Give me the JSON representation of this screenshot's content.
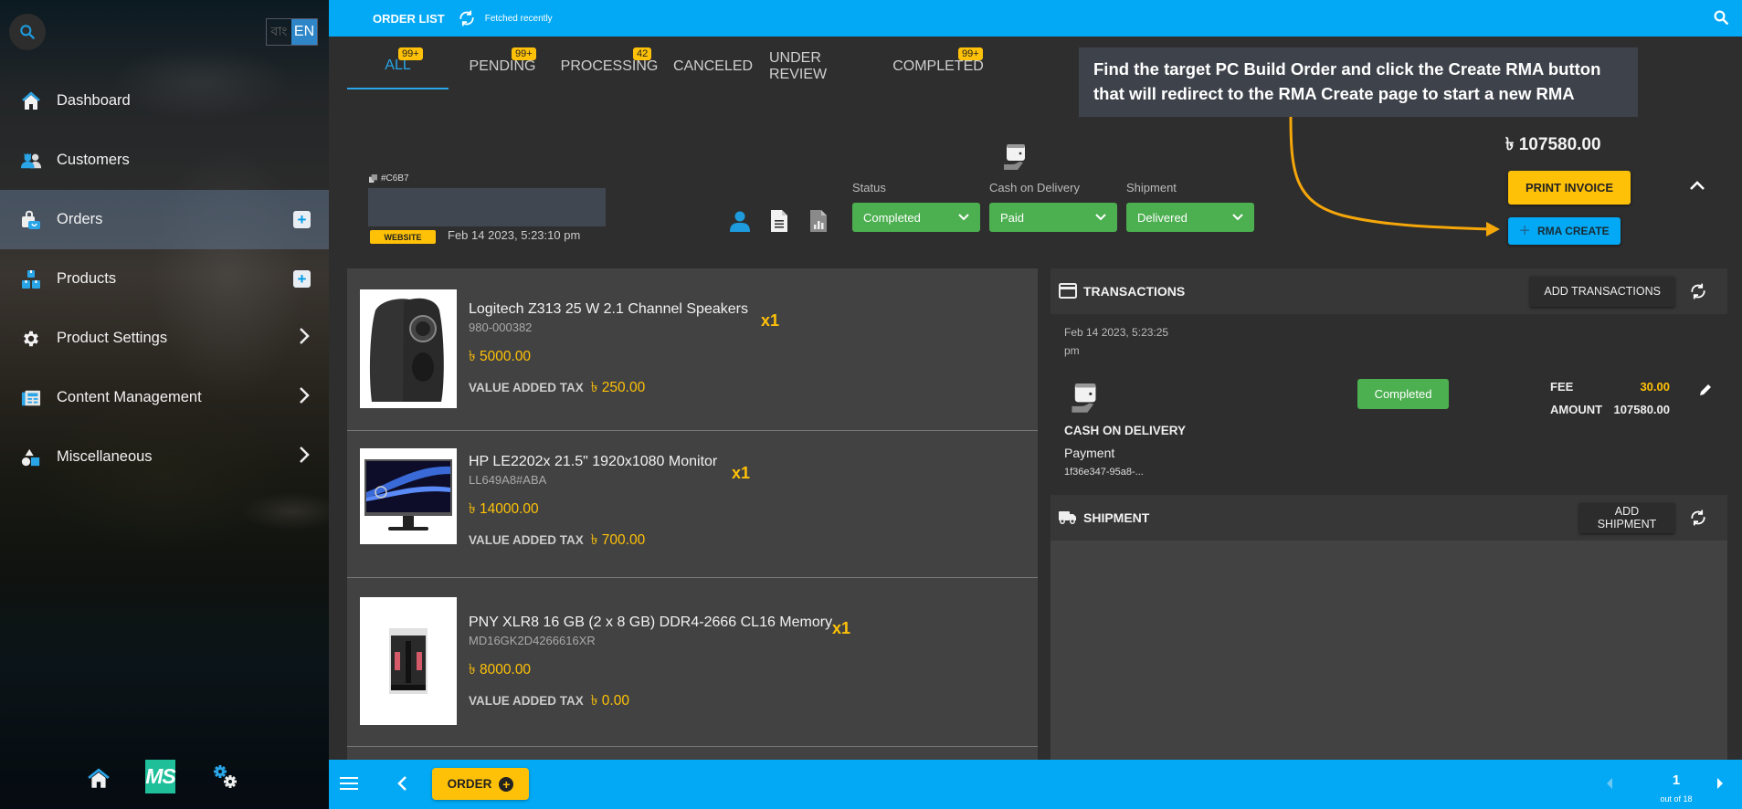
{
  "sidebar": {
    "lang": {
      "bn": "বাং",
      "en": "EN"
    },
    "items": [
      {
        "label": "Dashboard",
        "icon": "home-icon",
        "action": "none"
      },
      {
        "label": "Customers",
        "icon": "customers-icon",
        "action": "none"
      },
      {
        "label": "Orders",
        "icon": "orders-bag-icon",
        "action": "plus",
        "active": true
      },
      {
        "label": "Products",
        "icon": "products-boxes-icon",
        "action": "plus"
      },
      {
        "label": "Product Settings",
        "icon": "gear-icon",
        "action": "chevron"
      },
      {
        "label": "Content Management",
        "icon": "newspaper-icon",
        "action": "chevron"
      },
      {
        "label": "Miscellaneous",
        "icon": "shapes-icon",
        "action": "chevron"
      }
    ],
    "plus_symbol": "+",
    "chevron_symbol": "›",
    "bottom": {
      "logo_text": "MS"
    }
  },
  "topbar": {
    "title": "ORDER LIST",
    "fetched": "Fetched recently"
  },
  "tabs": [
    {
      "label": "ALL",
      "badge": "99+",
      "active": true
    },
    {
      "label": "PENDING",
      "badge": "99+"
    },
    {
      "label": "PROCESSING",
      "badge": "42"
    },
    {
      "label": "CANCELED",
      "badge": ""
    },
    {
      "label": "UNDER REVIEW",
      "badge": ""
    },
    {
      "label": "COMPLETED",
      "badge": "99+"
    }
  ],
  "instruction": "Find the target PC Build Order and click the Create RMA button that will redirect to the RMA Create page to start a new RMA",
  "order": {
    "id": "#C6B7",
    "source": "WEBSITE",
    "date": "Feb 14 2023, 5:23:10 pm",
    "status_label": "Status",
    "status_value": "Completed",
    "payment_label": "Cash on Delivery",
    "payment_value": "Paid",
    "shipment_label": "Shipment",
    "shipment_value": "Delivered",
    "total": "৳ 107580.00",
    "print_invoice": "PRINT INVOICE",
    "rma_create": "RMA CREATE",
    "rma_plus": "+"
  },
  "products": [
    {
      "name": "Logitech Z313 25 W 2.1 Channel Speakers",
      "sku": "980-000382",
      "price": "৳ 5000.00",
      "vat_label": "VALUE ADDED TAX",
      "vat": "৳ 250.00",
      "qty": "x1",
      "image": "speaker"
    },
    {
      "name": "HP LE2202x 21.5\" 1920x1080 Monitor",
      "sku": "LL649A8#ABA",
      "price": "৳ 14000.00",
      "vat_label": "VALUE ADDED TAX",
      "vat": "৳ 700.00",
      "qty": "x1",
      "image": "monitor"
    },
    {
      "name": "PNY XLR8 16 GB (2 x 8 GB) DDR4-2666 CL16 Memory",
      "sku": "MD16GK2D4266616XR",
      "price": "৳ 8000.00",
      "vat_label": "VALUE ADDED TAX",
      "vat": "৳ 0.00",
      "qty": "x1",
      "image": "memory"
    }
  ],
  "transactions": {
    "title": "TRANSACTIONS",
    "add_button": "ADD TRANSACTIONS",
    "date": "Feb 14 2023, 5:23:25 pm",
    "method": "CASH ON DELIVERY",
    "type": "Payment",
    "id": "1f36e347-95a8-...",
    "status": "Completed",
    "fee_label": "FEE",
    "fee": "30.00",
    "amount_label": "AMOUNT",
    "amount": "107580.00"
  },
  "shipment": {
    "title": "SHIPMENT",
    "add_button": "ADD SHIPMENT"
  },
  "bottombar": {
    "order_button": "ORDER",
    "order_plus": "+",
    "page": "1",
    "page_total": "out of 18"
  },
  "colors": {
    "accent": "#03a9f4",
    "warning": "#ffc107",
    "success": "#4caf50"
  }
}
